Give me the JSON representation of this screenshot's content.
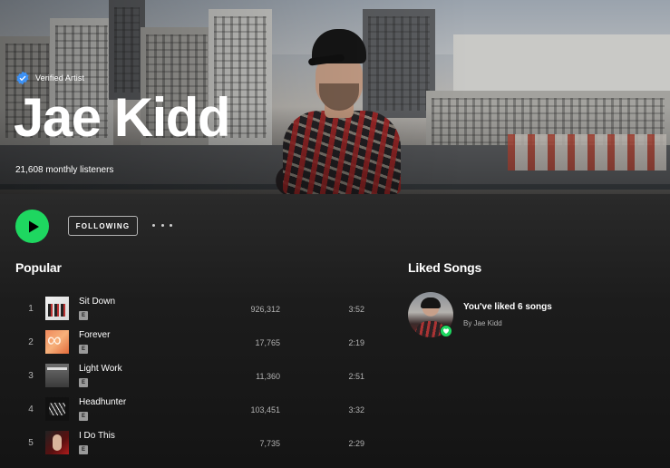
{
  "artist": {
    "verified_label": "Verified Artist",
    "name": "Jae Kidd",
    "monthly_listeners": "21,608 monthly listeners"
  },
  "controls": {
    "following_label": "FOLLOWING",
    "play_icon": "play-icon",
    "more_icon": "more-options-icon",
    "accent_color": "#1ed760"
  },
  "popular": {
    "title": "Popular",
    "tracks": [
      {
        "num": "1",
        "name": "Sit Down",
        "explicit": "E",
        "plays": "926,312",
        "duration": "3:52"
      },
      {
        "num": "2",
        "name": "Forever",
        "explicit": "E",
        "plays": "17,765",
        "duration": "2:19"
      },
      {
        "num": "3",
        "name": "Light Work",
        "explicit": "E",
        "plays": "11,360",
        "duration": "2:51"
      },
      {
        "num": "4",
        "name": "Headhunter",
        "explicit": "E",
        "plays": "103,451",
        "duration": "3:32"
      },
      {
        "num": "5",
        "name": "I Do This",
        "explicit": "E",
        "plays": "7,735",
        "duration": "2:29"
      }
    ]
  },
  "liked": {
    "title": "Liked Songs",
    "count_text": "You've liked 6 songs",
    "by_text": "By Jae Kidd"
  }
}
